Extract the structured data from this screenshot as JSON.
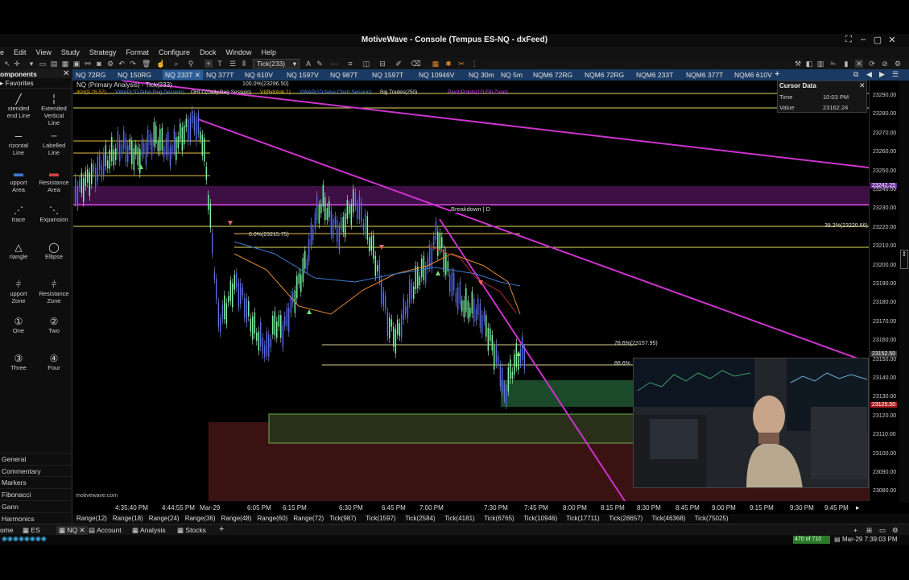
{
  "window": {
    "title": "MotiveWave - Console (Tempus ES-NQ - dxFeed)"
  },
  "menu": [
    "e",
    "Edit",
    "View",
    "Study",
    "Strategy",
    "Format",
    "Configure",
    "Dock",
    "Window",
    "Help"
  ],
  "toolbar": {
    "bar_type": "Tick(233)"
  },
  "left_panel": {
    "header": "omponents",
    "favorites": "Favorites",
    "tools": [
      {
        "label": "xtended\nend Line",
        "icon": "trend-line-icon"
      },
      {
        "label": "Extended\nVertical\nLine",
        "icon": "vertical-line-icon"
      },
      {
        "label": "rizontal\nLine",
        "icon": "horizontal-line-icon"
      },
      {
        "label": "Labelled\nLine",
        "icon": "labelled-line-icon"
      },
      {
        "label": "upport\nArea",
        "icon": "support-area-icon"
      },
      {
        "label": "Resistance\nArea",
        "icon": "resistance-area-icon"
      },
      {
        "label": "tracе",
        "icon": "retrace-icon"
      },
      {
        "label": "Expansion",
        "icon": "expansion-icon"
      },
      {
        "label": "riangle",
        "icon": "triangle-icon"
      },
      {
        "label": "Ellipse",
        "icon": "ellipse-icon"
      },
      {
        "label": "upport\nZone",
        "icon": "support-zone-icon"
      },
      {
        "label": "Resistance\nZone",
        "icon": "resistance-zone-icon"
      },
      {
        "label": "One",
        "icon": "label-one-icon"
      },
      {
        "label": "Two",
        "icon": "label-two-icon"
      },
      {
        "label": "Three",
        "icon": "label-three-icon"
      },
      {
        "label": "Four",
        "icon": "label-four-icon"
      }
    ],
    "sections": [
      "General",
      "Commentary",
      "Markers",
      "Fibonacci",
      "Gann",
      "Harmonics"
    ]
  },
  "chart_tabs": [
    "NQ 72RG",
    "NQ 150RG",
    "NQ 233T",
    "NQ 377T",
    "NQ 610V",
    "NQ 1597V",
    "NQ 987T",
    "NQ 1597T",
    "NQ 10946V",
    "NQ 30m",
    "NQ 5m",
    "NQM6 72RG",
    "NQM6 72RG",
    "NQM6 233T",
    "NQM6 377T",
    "NQM6 610V"
  ],
  "active_tab_index": 2,
  "chart": {
    "header": "NQ (Primary Analysis) - Tick(233)",
    "top_label": "100.0%(23296.50)",
    "indicators": [
      {
        "text": "IKH(9,26,52)",
        "color": "#e0a000"
      },
      {
        "text": "VWAP(1D,false,Reg Session)",
        "color": "#4a86ff"
      },
      {
        "text": "OHLC(Daily,Reg Session)",
        "color": "#e0e0e0"
      },
      {
        "text": "VI(Bid/Ask,1)",
        "color": "#e0c000"
      },
      {
        "text": "VWAP(1D,false,Chart Session)",
        "color": "#4a86ff"
      },
      {
        "text": "Big Trades(250)",
        "color": "#e0e0e0"
      },
      {
        "text": "Pivot(Points(1D,Fib Zone)",
        "color": "#cc44ff"
      }
    ],
    "annotations": {
      "breakdown": "Breakdown | D",
      "fib0": "0.0%(23215.75)",
      "fib382": "38.2%(23220.66)",
      "fib786": "78.6%(23157.95)",
      "fib886": "88.6%",
      "watermark": "motivewave.com"
    },
    "y_ticks": [
      "23290.00",
      "23280.00",
      "23270.00",
      "23260.00",
      "23250.00",
      "23240.00",
      "23230.00",
      "23220.00",
      "23210.00",
      "23200.00",
      "23190.00",
      "23180.00",
      "23170.00",
      "23160.00",
      "23150.00",
      "23140.00",
      "23130.00",
      "23120.00",
      "23110.00",
      "23100.00",
      "23090.00",
      "23080.00"
    ],
    "y_badges": [
      {
        "text": "23242.25",
        "color": "#6a2a9a"
      },
      {
        "text": "23152.50",
        "color": "#3a3a3a"
      },
      {
        "text": "23125.50",
        "color": "#b02020"
      }
    ],
    "x_ticks": [
      "4:35:40 PM",
      "4:44:55 PM",
      "Mar-29",
      "6:05 PM",
      "6:15 PM",
      "6:30 PM",
      "6:45 PM",
      "7:00 PM",
      "7:30 PM",
      "7:45 PM",
      "8:00 PM",
      "8:15 PM",
      "8:30 PM",
      "8:45 PM",
      "9:00 PM",
      "9:15 PM",
      "9:30 PM",
      "9:45 PM"
    ]
  },
  "cursor_data": {
    "title": "Cursor Data",
    "time_label": "Time",
    "time_value": "10:03 PM",
    "value_label": "Value",
    "value_value": "23162.24"
  },
  "range_buttons": [
    "Range(12)",
    "Range(18)",
    "Range(24)",
    "Range(36)",
    "Range(48)",
    "Range(60)",
    "Range(72)",
    "Tick(987)",
    "Tick(1597)",
    "Tick(2584)",
    "Tick(4181)",
    "Tick(6765)",
    "Tick(10946)",
    "Tick(17711)",
    "Tick(28657)",
    "Tick(46368)",
    "Tick(75025)"
  ],
  "bottom_tabs": [
    "ome",
    "ES",
    "NQ",
    "Account",
    "Analysis",
    "Stocks"
  ],
  "status": {
    "memory": "470 of 710",
    "datetime": "Mar-29  7:39:03 PM"
  }
}
